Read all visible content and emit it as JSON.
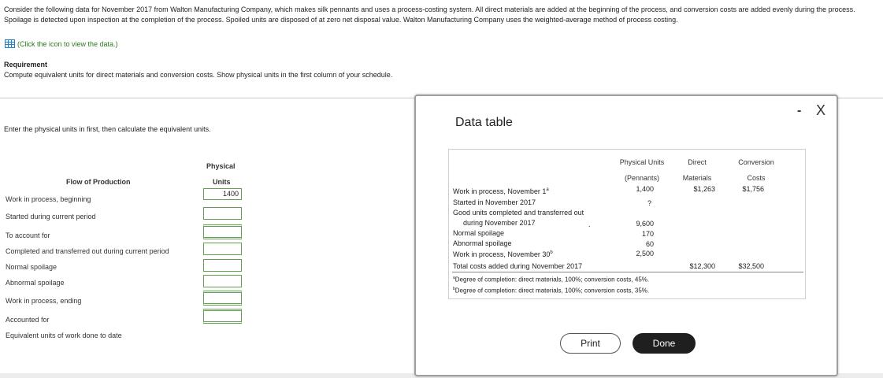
{
  "intro": "Consider the following data for November 2017 from Walton Manufacturing Company, which makes silk pennants and uses a process-costing system. All direct materials are added at the beginning of the process, and conversion costs are added evenly during the process. Spoilage is detected upon inspection at the completion of the process. Spoiled units are disposed of at zero net disposal value. Walton Manufacturing Company uses the weighted-average method of process costing.",
  "data_link": "(Click the icon to view the data.)",
  "requirement": {
    "title": "Requirement",
    "text": "Compute equivalent units for direct materials and conversion costs. Show physical units in the first column of your schedule."
  },
  "instruction": "Enter the physical units in first, then calculate the equivalent units.",
  "schedule": {
    "col_physical": "Physical",
    "col_units": "Units",
    "col_flow": "Flow of Production",
    "rows": [
      {
        "label": "Work in process, beginning",
        "value": "1400"
      },
      {
        "label": "Started during current period",
        "value": ""
      },
      {
        "label": "To account for",
        "value": ""
      },
      {
        "label": "Completed and transferred out during current period",
        "value": ""
      },
      {
        "label": "Normal spoilage",
        "value": ""
      },
      {
        "label": "Abnormal spoilage",
        "value": ""
      },
      {
        "label": "Work in process, ending",
        "value": ""
      },
      {
        "label": "Accounted for",
        "value": ""
      },
      {
        "label": "Equivalent units of work done to date",
        "value": ""
      }
    ]
  },
  "modal": {
    "title": "Data table",
    "minimize": "-",
    "close": "X",
    "table": {
      "headers": {
        "pu1": "Physical Units",
        "pu2": "(Pennants)",
        "dm1": "Direct",
        "dm2": "Materials",
        "cc1": "Conversion",
        "cc2": "Costs"
      },
      "rows": [
        {
          "label": "Work in process, November 1",
          "sup": "a",
          "pu": "1,400",
          "dm": "$1,263",
          "cc": "$1,756"
        },
        {
          "label": "Started in November 2017",
          "pu": "?"
        },
        {
          "label": "Good units completed and transferred out"
        },
        {
          "label": "during November 2017",
          "pu": "9,600"
        },
        {
          "label": "Normal spoilage",
          "pu": "170"
        },
        {
          "label": "Abnormal spoilage",
          "pu": "60"
        },
        {
          "label": "Work in process, November 30",
          "sup": "b",
          "pu": "2,500"
        },
        {
          "label": "Total costs added during November 2017",
          "dm": "$12,300",
          "cc": "$32,500"
        }
      ],
      "footnotes": [
        {
          "mark": "a",
          "text": "Degree of completion: direct materials, 100%; conversion costs, 45%."
        },
        {
          "mark": "b",
          "text": "Degree of completion: direct materials, 100%; conversion costs, 35%."
        }
      ],
      "stray_dot": "."
    },
    "buttons": {
      "print": "Print",
      "done": "Done"
    }
  },
  "colors": {
    "accent": "#5fa14c",
    "link": "#2c7a1c",
    "done_bg": "#1f1f1f"
  }
}
